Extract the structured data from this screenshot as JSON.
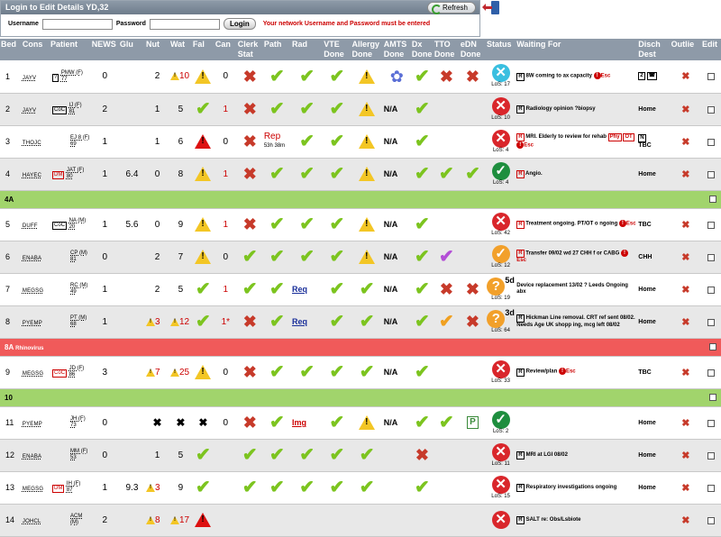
{
  "login": {
    "title": "Login to Edit Details YD,32",
    "refresh_label": "Refresh",
    "username_label": "Username",
    "password_label": "Password",
    "login_button": "Login",
    "warning": "Your network Username and Password must be entered"
  },
  "headers": {
    "bed": "Bed",
    "cons": "Cons",
    "patient": "Patient",
    "news": "NEWS",
    "glu": "Glu",
    "nut": "Nut",
    "wat": "Wat",
    "fal": "Fal",
    "can": "Can",
    "clerk": "Clerk Stat",
    "path": "Path",
    "rad": "Rad",
    "vte": "VTE Done",
    "allergy": "Allergy Done",
    "amts": "AMTS Done",
    "dx": "Dx Done",
    "tto": "TTO Done",
    "edn": "eDN Done",
    "status": "Status",
    "waiting": "Waiting For",
    "disch": "Disch Dest",
    "outlie": "Outlie",
    "edit": "Edit"
  },
  "sections": {
    "s4a": "4A",
    "s8a": "8A",
    "s8a_note": "Rhinovirus",
    "s10": "10"
  },
  "rows": [
    {
      "bed": "1",
      "cons": "JAYV",
      "tag": "?",
      "patient": "PMW (F)",
      "age": "77",
      "news": "0",
      "nut": "2",
      "wat": "10",
      "can": "0",
      "los": "LoS: 17",
      "wait": "8W coming to ax capacity",
      "esc": "Esc",
      "dest": ""
    },
    {
      "bed": "2",
      "cons": "JAYV",
      "tag": "CoC",
      "patient": "IJ (F)",
      "age": "81",
      "news": "2",
      "nut": "1",
      "wat": "5",
      "can": "1",
      "amts": "N/A",
      "los": "LoS: 10",
      "wait": "Radiology opinion ?biopsy",
      "dest": "Home"
    },
    {
      "bed": "3",
      "cons": "THOJC",
      "patient": "EJ 8 (F)",
      "age": "69",
      "news": "1",
      "nut": "1",
      "wat": "6",
      "can": "0",
      "path": "Rep",
      "path_time": "53h 38m",
      "amts": "N/A",
      "los": "LoS: 4",
      "wait": "MRI. Elderly to review for rehab",
      "tags": [
        "Phy",
        "OT"
      ],
      "esc": "Esc",
      "dest": "TBC"
    },
    {
      "bed": "4",
      "cons": "HAYEC",
      "tag": "DM",
      "patient": "JAT (F)",
      "age": "80",
      "news": "1",
      "glu": "6.4",
      "nut": "0",
      "wat": "8",
      "can": "1",
      "amts": "N/A",
      "los": "LoS: 4",
      "wait": "Angio.",
      "dest": "Home"
    },
    {
      "bed": "5",
      "cons": "DUFF",
      "tag": "CoC",
      "patient": "NA (M)",
      "age": "20",
      "news": "1",
      "glu": "5.6",
      "nut": "0",
      "wat": "9",
      "can": "1",
      "amts": "N/A",
      "los": "LoS: 42",
      "wait": "Treatment ongoing. PT/OT o ngoing",
      "esc": "Esc",
      "dest": "TBC"
    },
    {
      "bed": "6",
      "cons": "ENABA",
      "patient": "CP (M)",
      "age": "81",
      "news": "0",
      "nut": "2",
      "wat": "7",
      "can": "0",
      "amts": "N/A",
      "los": "LoS: 12",
      "wait": "Transfer 09/02 wd 27 CHH f or CABG",
      "esc": "Esc",
      "dest": "CHH"
    },
    {
      "bed": "7",
      "cons": "MEGSG",
      "patient": "RC (M)",
      "age": "49",
      "news": "1",
      "nut": "2",
      "wat": "5",
      "can": "1",
      "rad": "Req",
      "amts": "N/A",
      "days": "5d",
      "los": "LoS: 19",
      "wait": "Device replacement 13/02 ? Leeds Ongoing abx",
      "dest": "Home"
    },
    {
      "bed": "8",
      "cons": "PYEMP",
      "patient": "PT (M)",
      "age": "68",
      "news": "1",
      "nut": "3",
      "wat": "12",
      "can": "1*",
      "rad": "Req",
      "amts": "N/A",
      "days": "3d",
      "los": "LoS: 64",
      "wait": "Hickman Line removal. CRT ref sent 08/02. Needs Age UK shopp ing, mcg left 08/02",
      "dest": "Home"
    },
    {
      "bed": "9",
      "cons": "MEGSG",
      "tag": "CoC",
      "patient": "JD (F)",
      "age": "86",
      "news": "3",
      "nut": "7",
      "wat": "25",
      "can": "0",
      "amts": "N/A",
      "los": "LoS: 33",
      "wait": "Review/plan",
      "esc": "Esc",
      "dest": "TBC"
    },
    {
      "bed": "11",
      "cons": "PYEMP",
      "patient": "JH (F)",
      "age": "73",
      "news": "0",
      "rad": "Img",
      "amts": "N/A",
      "edn": "P",
      "los": "LoS: 2",
      "wait": "",
      "dest": "Home"
    },
    {
      "bed": "12",
      "cons": "ENABA",
      "patient": "MM (F)",
      "age": "53",
      "news": "0",
      "nut": "1",
      "wat": "5",
      "los": "LoS: 11",
      "wait": "MRI at LGI 08/02",
      "dest": "Home"
    },
    {
      "bed": "13",
      "cons": "MEGSG",
      "tag": "DM",
      "patient": "IH (F)",
      "age": "87",
      "news": "1",
      "glu": "9.3",
      "nut": "3",
      "wat": "9",
      "los": "LoS: 15",
      "wait": "Respiratory investigations ongoing",
      "dest": "Home"
    },
    {
      "bed": "14",
      "cons": "JOHCL",
      "patient": "ACM (M)",
      "age": "",
      "news": "2",
      "nut": "8",
      "wat": "17",
      "los": "",
      "wait": "SALT re: Obs/Lsbiote",
      "dest": ""
    }
  ]
}
